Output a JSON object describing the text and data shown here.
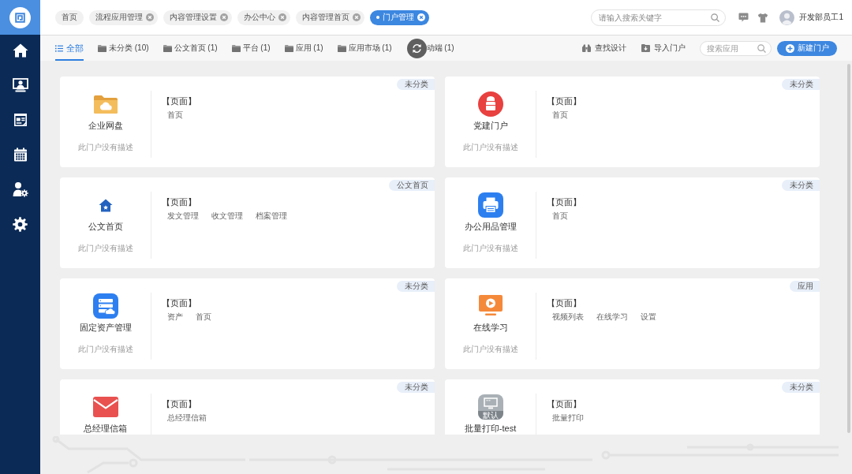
{
  "open_pages": [
    {
      "label": "首页",
      "closable": false,
      "selected": false
    },
    {
      "label": "流程应用管理",
      "closable": true,
      "selected": false
    },
    {
      "label": "内容管理设置",
      "closable": true,
      "selected": false
    },
    {
      "label": "办公中心",
      "closable": true,
      "selected": false
    },
    {
      "label": "内容管理首页",
      "closable": true,
      "selected": false
    },
    {
      "label": "门户管理",
      "closable": true,
      "selected": true
    }
  ],
  "search": {
    "placeholder": "请输入搜索关键字"
  },
  "user": {
    "name": "开发部员工1"
  },
  "tabs": [
    {
      "label": "全部",
      "kind": "all",
      "selected": true
    },
    {
      "label": "未分类 (10)",
      "kind": "folder",
      "selected": false
    },
    {
      "label": "公文首页 (1)",
      "kind": "folder",
      "selected": false
    },
    {
      "label": "平台 (1)",
      "kind": "folder",
      "selected": false
    },
    {
      "label": "应用 (1)",
      "kind": "folder",
      "selected": false
    },
    {
      "label": "应用市场 (1)",
      "kind": "folder",
      "selected": false
    },
    {
      "label": "动端 (1)",
      "kind": "covered",
      "selected": false
    }
  ],
  "actions": [
    {
      "label": "查找设计",
      "kind": "find"
    },
    {
      "label": "导入门户",
      "kind": "import"
    }
  ],
  "app_search": {
    "placeholder": "搜索应用"
  },
  "new_button": {
    "label": "新建门户"
  },
  "portals": [
    {
      "name": "企业网盘",
      "kind": "cloud",
      "description": "此门户没有描述",
      "category": "未分类",
      "pages_heading": "【页面】",
      "pages": [
        "首页"
      ]
    },
    {
      "name": "党建门户",
      "kind": "party",
      "description": "此门户没有描述",
      "category": "未分类",
      "pages_heading": "【页面】",
      "pages": [
        "首页"
      ]
    },
    {
      "name": "公文首页",
      "kind": "house",
      "description": "此门户没有描述",
      "category": "公文首页",
      "pages_heading": "【页面】",
      "pages": [
        "发文管理",
        "收文管理",
        "档案管理"
      ]
    },
    {
      "name": "办公用品管理",
      "kind": "printer",
      "description": "此门户没有描述",
      "category": "未分类",
      "pages_heading": "【页面】",
      "pages": [
        "首页"
      ]
    },
    {
      "name": "固定资产管理",
      "kind": "server",
      "description": "此门户没有描述",
      "category": "未分类",
      "pages_heading": "【页面】",
      "pages": [
        "资产",
        "首页"
      ]
    },
    {
      "name": "在线学习",
      "kind": "video",
      "description": "此门户没有描述",
      "category": "应用",
      "pages_heading": "【页面】",
      "pages": [
        "视频列表",
        "在线学习",
        "设置"
      ]
    },
    {
      "name": "总经理信箱",
      "kind": "mail",
      "category": "未分类",
      "pages_heading": "【页面】",
      "pages": [
        "总经理信箱"
      ]
    },
    {
      "name": "批量打印-test",
      "kind": "monitor",
      "icon_label": "默认",
      "category": "未分类",
      "pages_heading": "【页面】",
      "pages": [
        "批量打印"
      ]
    }
  ]
}
